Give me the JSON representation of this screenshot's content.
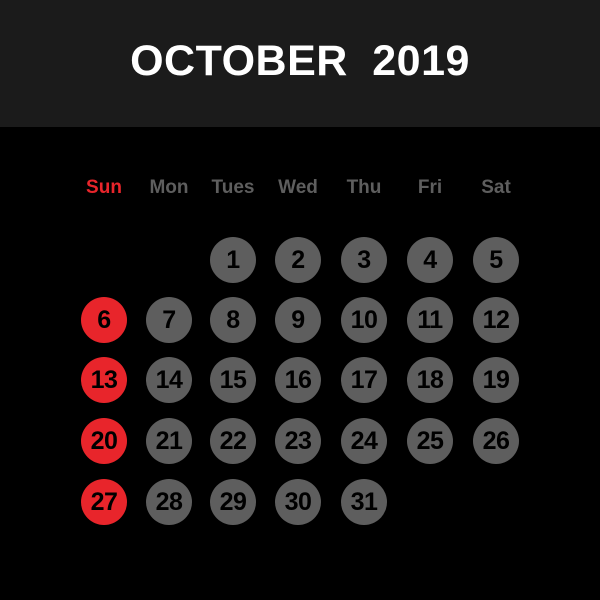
{
  "header": {
    "title": "OCTOBER  2019",
    "month": "OCTOBER",
    "year": "2019"
  },
  "weekdays": [
    "Sun",
    "Mon",
    "Tues",
    "Wed",
    "Thu",
    "Fri",
    "Sat"
  ],
  "colors": {
    "background": "#000000",
    "header_bg": "#1b1b1b",
    "title": "#ffffff",
    "sunday": "#e8252b",
    "weekday": "#5e5e5e",
    "day_number": "#000000"
  },
  "first_weekday_index": 2,
  "days_in_month": 31,
  "weeks": [
    [
      null,
      null,
      "1",
      "2",
      "3",
      "4",
      "5"
    ],
    [
      "6",
      "7",
      "8",
      "9",
      "10",
      "11",
      "12"
    ],
    [
      "13",
      "14",
      "15",
      "16",
      "17",
      "18",
      "19"
    ],
    [
      "20",
      "21",
      "22",
      "23",
      "24",
      "25",
      "26"
    ],
    [
      "27",
      "28",
      "29",
      "30",
      "31",
      null,
      null
    ]
  ]
}
